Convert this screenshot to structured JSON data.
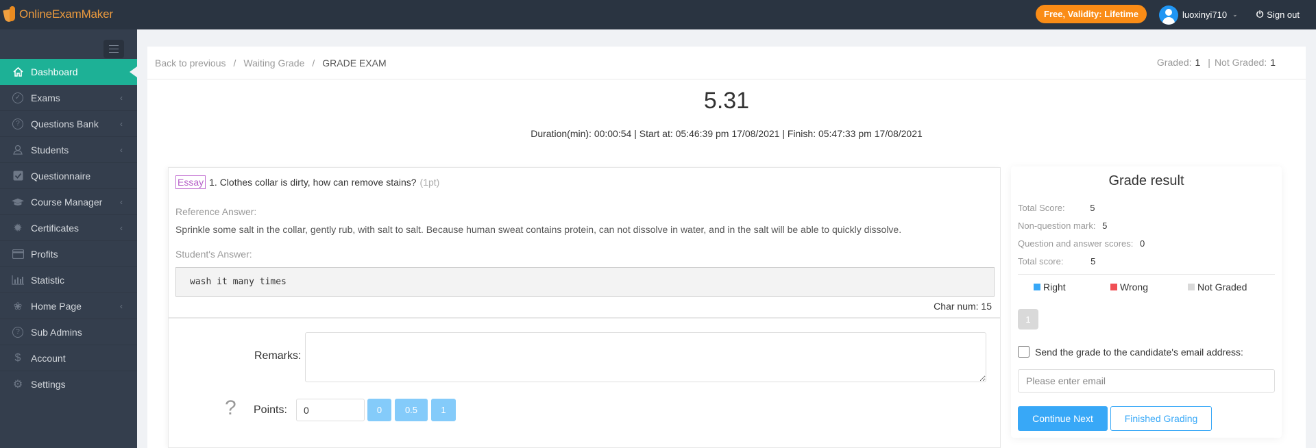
{
  "header": {
    "logo_text": "OnlineExamMaker",
    "plan_badge": "Free, Validity: Lifetime",
    "username": "luoxinyi710",
    "signout_label": "Sign out"
  },
  "sidebar": {
    "items": [
      {
        "label": "Dashboard",
        "icon": "home-icon",
        "active": true,
        "has_submenu": false
      },
      {
        "label": "Exams",
        "icon": "check-circle-icon",
        "has_submenu": true
      },
      {
        "label": "Questions Bank",
        "icon": "question-circle-icon",
        "has_submenu": true
      },
      {
        "label": "Students",
        "icon": "users-icon",
        "has_submenu": true
      },
      {
        "label": "Questionnaire",
        "icon": "checkbox-icon",
        "has_submenu": false
      },
      {
        "label": "Course Manager",
        "icon": "graduation-cap-icon",
        "has_submenu": true
      },
      {
        "label": "Certificates",
        "icon": "badge-icon",
        "has_submenu": true
      },
      {
        "label": "Profits",
        "icon": "credit-card-icon",
        "has_submenu": false
      },
      {
        "label": "Statistic",
        "icon": "bar-chart-icon",
        "has_submenu": false
      },
      {
        "label": "Home Page",
        "icon": "plant-icon",
        "has_submenu": true
      },
      {
        "label": "Sub Admins",
        "icon": "question-circle-icon",
        "has_submenu": false
      },
      {
        "label": "Account",
        "icon": "dollar-icon",
        "has_submenu": false
      },
      {
        "label": "Settings",
        "icon": "gear-icon",
        "has_submenu": false
      }
    ]
  },
  "breadcrumb": {
    "items": [
      "Back to previous",
      "Waiting Grade",
      "GRADE EXAM"
    ],
    "separator": "/"
  },
  "grading_status": {
    "graded_label": "Graded",
    "graded_count": "1",
    "not_graded_label": "Not Graded",
    "not_graded_count": "1"
  },
  "exam": {
    "title": "5.31",
    "info": "Duration(min): 00:00:54 | Start at: 05:46:39 pm 17/08/2021 | Finish: 05:47:33 pm 17/08/2021"
  },
  "question": {
    "type": "Essay",
    "text": "1. Clothes collar is dirty, how can remove stains?",
    "points": "(1pt)",
    "reference_label": "Reference Answer:",
    "reference_answer": "Sprinkle some salt in the collar, gently rub, with salt to salt. Because human sweat contains protein, can not dissolve in water, and in the salt will be able to quickly dissolve.",
    "student_label": "Student's Answer:",
    "student_answer": "wash it many times",
    "char_num": "Char num: 15"
  },
  "grading_form": {
    "remarks_label": "Remarks:",
    "remarks_value": "",
    "help_icon": "?",
    "points_label": "Points:",
    "points_value": "0",
    "quick_points": [
      "0",
      "0.5",
      "1"
    ]
  },
  "grade_result": {
    "title": "Grade result",
    "rows": [
      {
        "label": "Total Score:",
        "value": "5"
      },
      {
        "label": "Non-question mark:",
        "value": "5"
      },
      {
        "label": "Question and answer scores:",
        "value": "0"
      },
      {
        "label": "Total score:",
        "value": "5"
      }
    ],
    "legend": [
      {
        "label": "Right",
        "color": "#38a8f7"
      },
      {
        "label": "Wrong",
        "color": "#f04f54"
      },
      {
        "label": "Not Graded",
        "color": "#d9d9d9"
      }
    ],
    "question_nav": [
      "1"
    ],
    "email_checkbox_label": "Send the grade to the candidate's email address:",
    "email_checked": false,
    "email_placeholder": "Please enter email",
    "continue_label": "Continue Next",
    "finish_label": "Finished Grading"
  }
}
